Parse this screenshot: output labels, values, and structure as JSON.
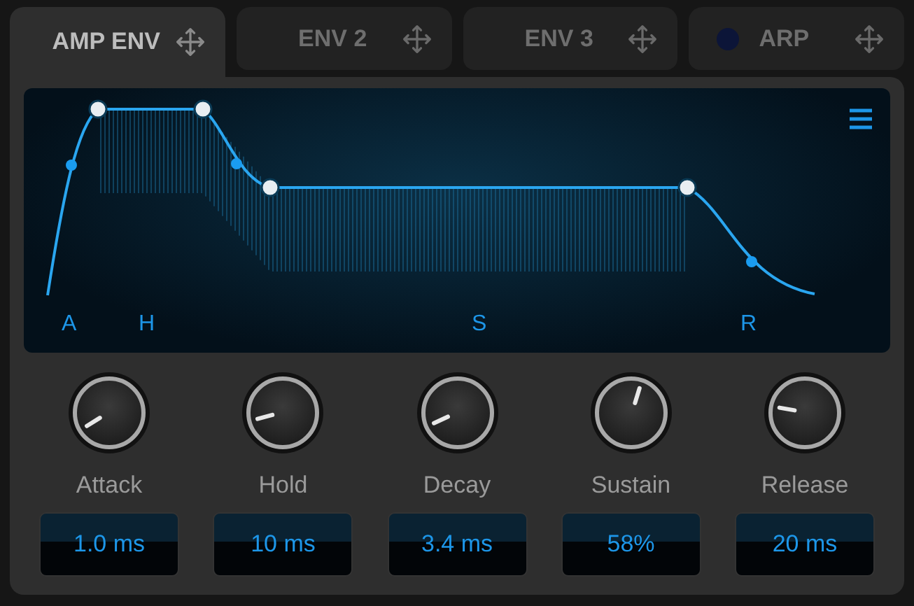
{
  "tabs": [
    {
      "label": "AMP ENV",
      "selected": true,
      "kind": "plain"
    },
    {
      "label": "ENV 2",
      "selected": false,
      "kind": "plain"
    },
    {
      "label": "ENV 3",
      "selected": false,
      "kind": "plain"
    },
    {
      "label": "ARP",
      "selected": false,
      "kind": "power",
      "on": false
    }
  ],
  "envelope": {
    "stage_labels": [
      "A",
      "H",
      "S",
      "R"
    ]
  },
  "knobs": [
    {
      "label": "Attack",
      "value": "1.0 ms"
    },
    {
      "label": "Hold",
      "value": "10 ms"
    },
    {
      "label": "Decay",
      "value": "3.4 ms"
    },
    {
      "label": "Sustain",
      "value": "58%"
    },
    {
      "label": "Release",
      "value": "20 ms"
    }
  ]
}
